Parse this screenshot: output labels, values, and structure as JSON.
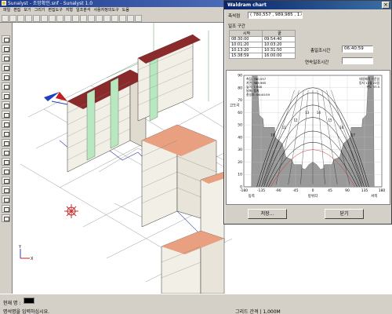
{
  "window": {
    "title": "Sunalyst - 조망확인.snf - Sunalyst 1.0"
  },
  "menubar": {
    "items": [
      "파일",
      "편집",
      "보기",
      "그리기",
      "편집도구",
      "지형",
      "일조분석",
      "사용자정의도구",
      "도움"
    ]
  },
  "statusbar": {
    "cmd_label": "현재 명 :",
    "message": "명석명을 입력하십시요.",
    "right": "그리드 간격 | 1,000M"
  },
  "dialog": {
    "title": "Waldram chart",
    "coord_label": "측석점",
    "coord_value": "( 780,557 , 989,985 , 1.600 )",
    "section_label": "일조 구간",
    "table_headers": [
      "시작",
      "끝"
    ],
    "table_rows": [
      [
        "08:30:00",
        "09:54:40"
      ],
      [
        "10:01:20",
        "10:03:20"
      ],
      [
        "10:13:20",
        "10:31:50"
      ],
      [
        "15:38:59",
        "16:00:00"
      ]
    ],
    "total_label": "총일조시간",
    "total_value": "06:40:59",
    "cont_label": "연속일조시간",
    "cont_value": "",
    "save_button": "저장...",
    "close_button": "닫기"
  },
  "chart_data": {
    "type": "area",
    "title": "",
    "xlabel": "",
    "ylabel": "고도각",
    "x_tick_values": [
      -180,
      -135,
      -90,
      -45,
      0,
      45,
      90,
      135,
      180
    ],
    "x_tick_labels": [
      "-180",
      "-135",
      "-90",
      "-45",
      "0",
      "45",
      "90",
      "135",
      "180"
    ],
    "x_direction_labels": [
      "동쪽",
      "방위각",
      "서쪽"
    ],
    "y_tick_values": [
      90,
      80,
      70,
      60,
      50,
      40,
      30,
      20,
      10,
      0
    ],
    "y_tick_labels": [
      "90",
      "80",
      "70",
      "60",
      "50",
      "40",
      "30",
      "20",
      "10",
      "0"
    ],
    "xlim": [
      -180,
      180
    ],
    "ylim": [
      0,
      90
    ],
    "grid": true,
    "obstruction_profile": {
      "azimuth": [
        -180,
        -160,
        -158,
        -145,
        -140,
        -130,
        -128,
        -100,
        -98,
        -80,
        -70,
        -55,
        -50,
        -30,
        -28,
        -20,
        -10,
        0,
        10,
        20,
        28,
        30,
        50,
        55,
        70,
        80,
        98,
        100,
        128,
        130,
        140,
        145,
        158,
        160,
        180
      ],
      "altitude": [
        0,
        0,
        90,
        90,
        58,
        55,
        48,
        48,
        40,
        35,
        24,
        22,
        18,
        18,
        15,
        14,
        18,
        20,
        18,
        14,
        15,
        18,
        18,
        22,
        24,
        35,
        40,
        48,
        48,
        55,
        58,
        90,
        90,
        0,
        0
      ]
    },
    "sun_paths": [
      {
        "name": "1",
        "peak": 30
      },
      {
        "name": "2",
        "peak": 36
      },
      {
        "name": "3",
        "peak": 45
      },
      {
        "name": "4",
        "peak": 56
      },
      {
        "name": "5",
        "peak": 66
      },
      {
        "name": "6",
        "peak": 76
      },
      {
        "name": "7",
        "peak": 80
      }
    ],
    "sun_path_label_numbers": [
      "10",
      "11",
      "12",
      "13",
      "14",
      "15",
      "16",
      "17"
    ],
    "info_left": [
      "측점: 780,557",
      "지면: 989,985",
      "높이: 1.600",
      "날짜: 동지",
      "총일조: 06:40:59"
    ],
    "info_right": [
      "태양궤적 기준일",
      "동지 12월 22일",
      "위도 37.5"
    ]
  }
}
